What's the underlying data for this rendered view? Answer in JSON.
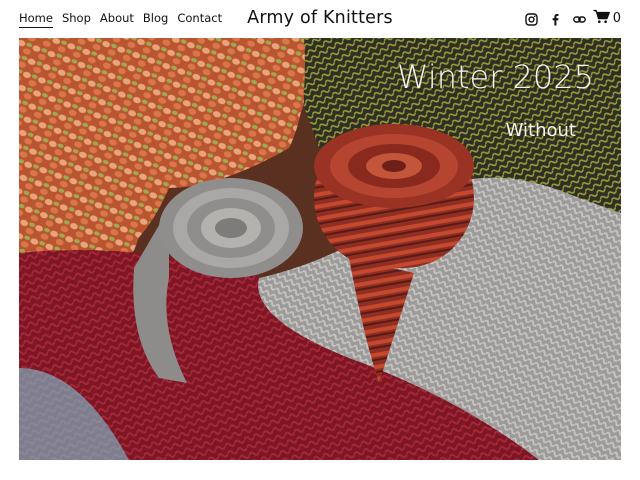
{
  "nav": {
    "items": [
      {
        "label": "Home",
        "active": true
      },
      {
        "label": "Shop"
      },
      {
        "label": "About"
      },
      {
        "label": "Blog"
      },
      {
        "label": "Contact"
      }
    ]
  },
  "site": {
    "title": "Army of Knitters"
  },
  "social": {
    "icons": [
      "instagram-icon",
      "facebook-icon",
      "link-icon"
    ]
  },
  "cart": {
    "icon": "cart-icon",
    "count": "0"
  },
  "hero": {
    "title": "Winter 2025",
    "subtitle": "Without",
    "colors": {
      "maroon": "#8e1b2a",
      "grey_yarn": "#a9a8a6",
      "rust_stripe": "#a8382a",
      "olive": "#5c5b2a",
      "pink_orange": "#d6744e"
    }
  }
}
